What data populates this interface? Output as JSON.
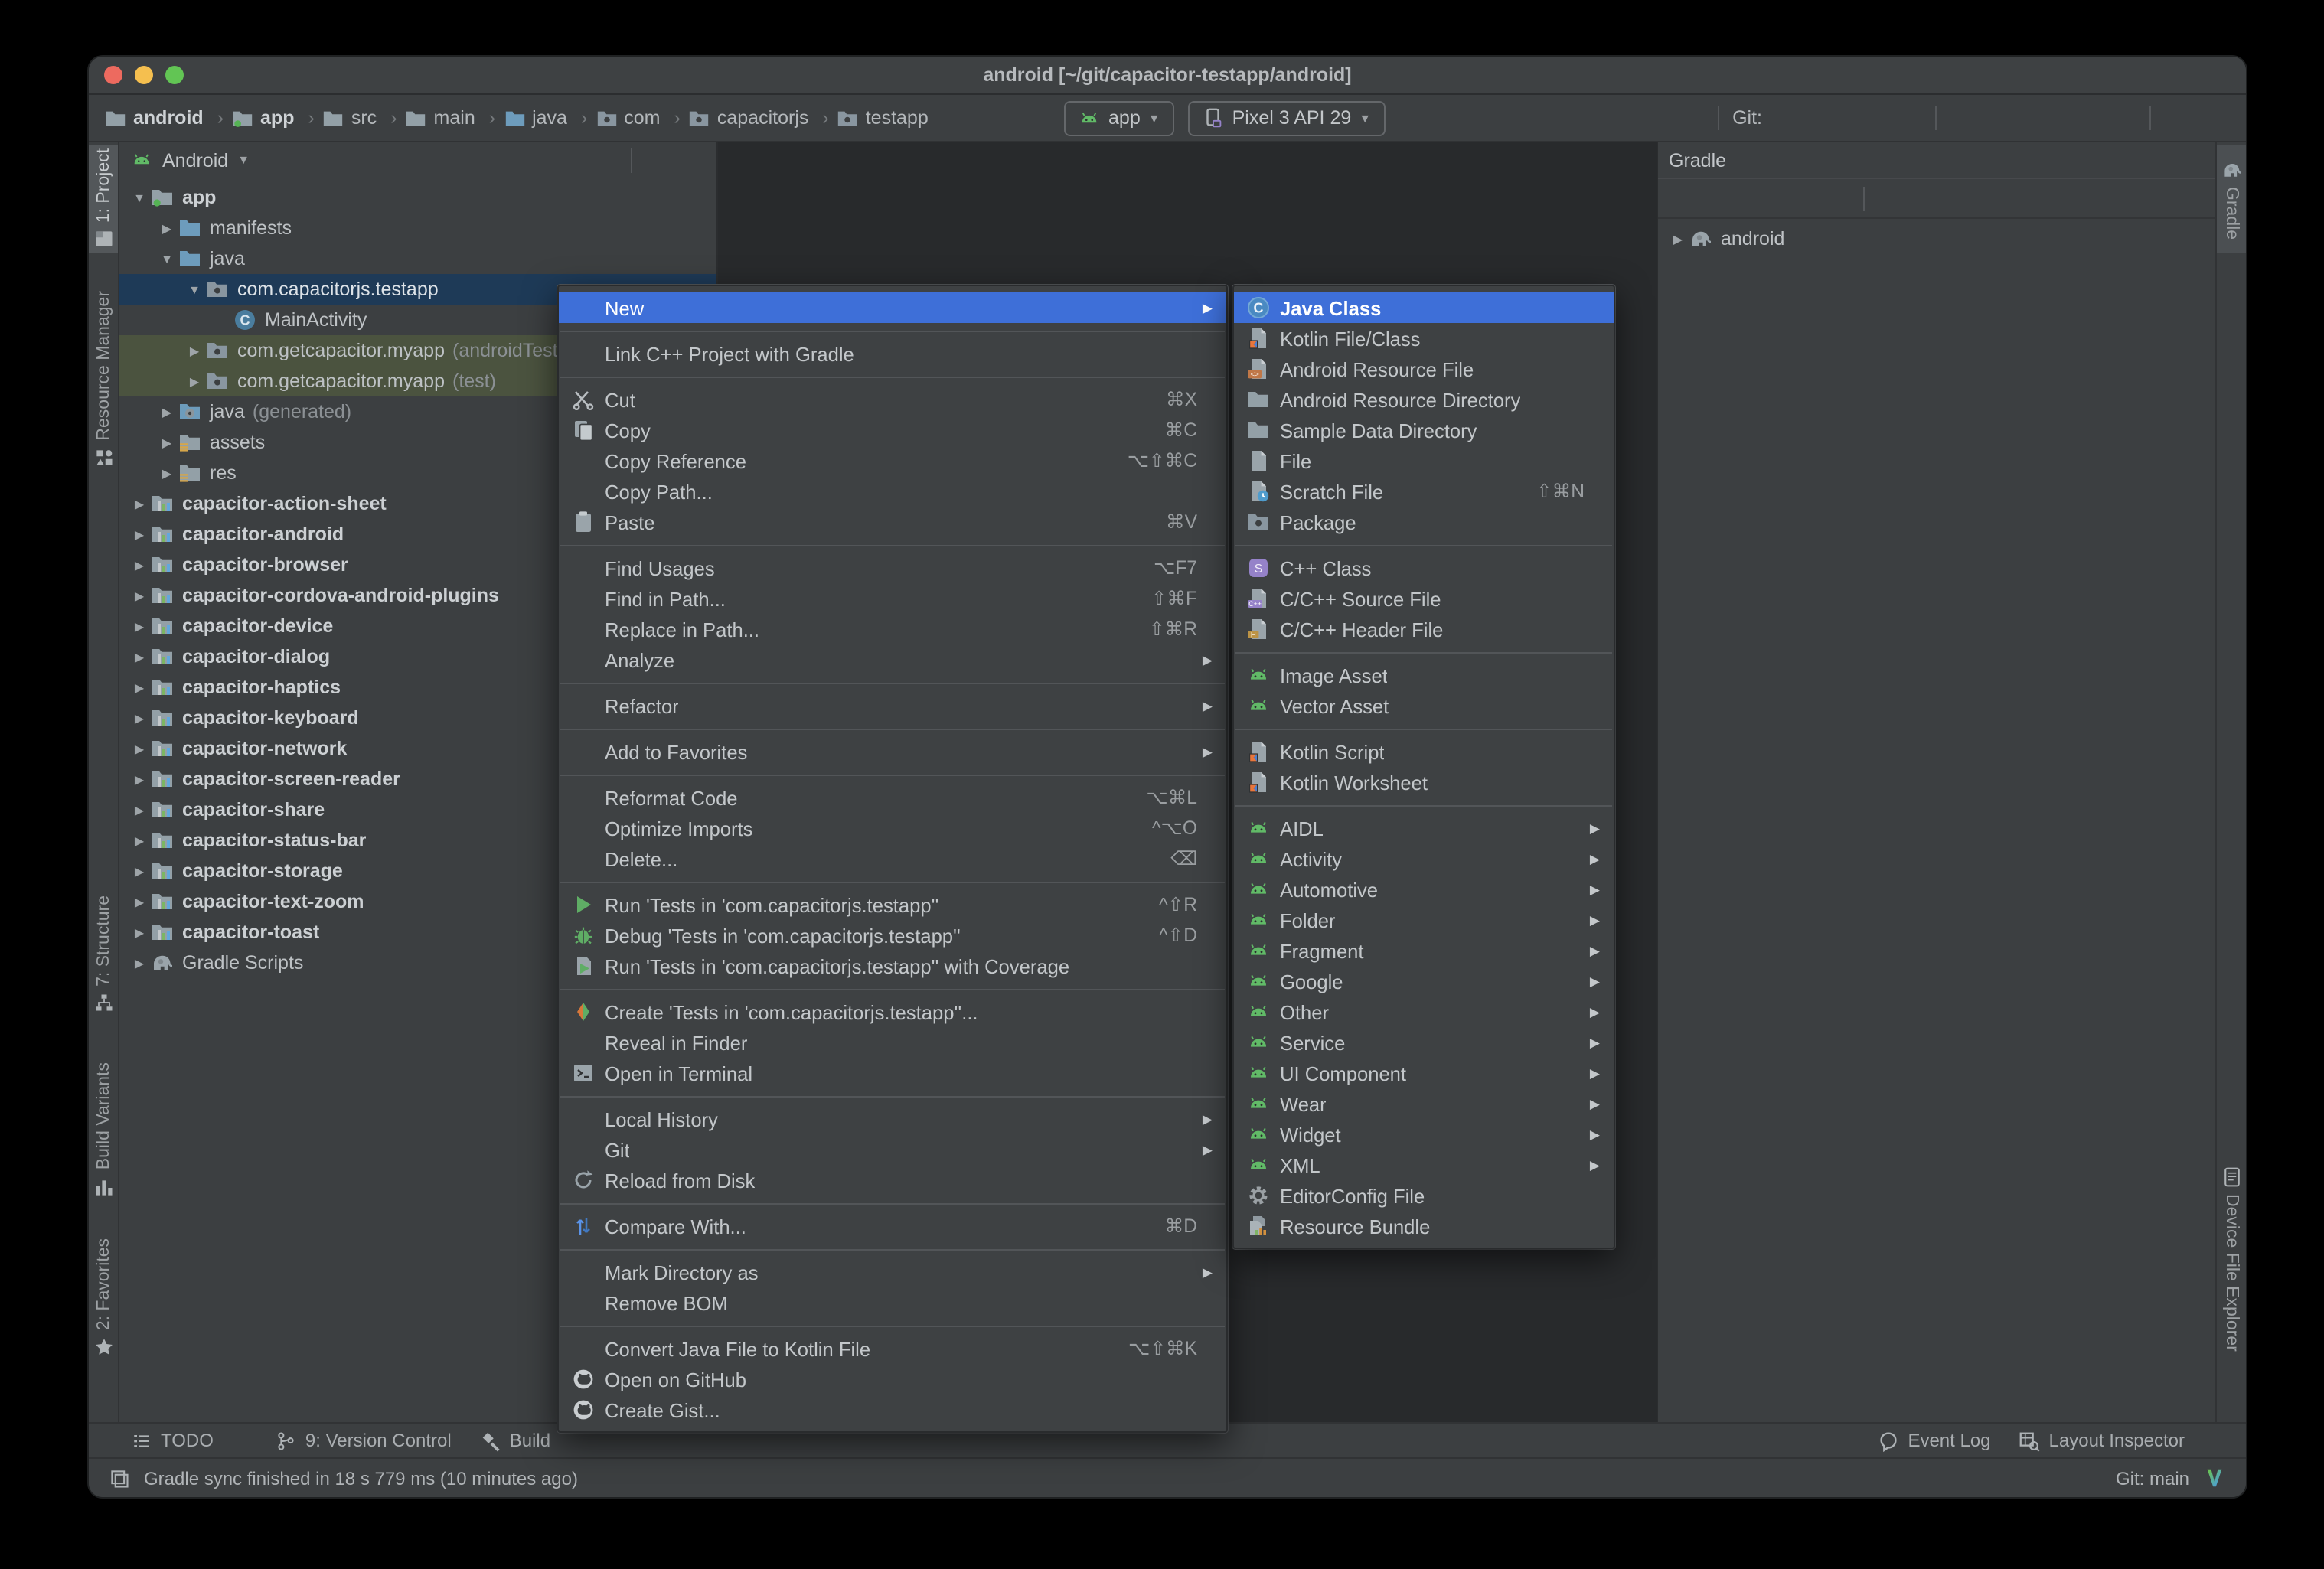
{
  "window": {
    "title": "android [~/git/capacitor-testapp/android]"
  },
  "toolbar": {
    "breadcrumbs": [
      {
        "label": "android",
        "icon": "folder-grey",
        "bold": true
      },
      {
        "label": "app",
        "icon": "folder-dot",
        "bold": true
      },
      {
        "label": "src",
        "icon": "folder-grey"
      },
      {
        "label": "main",
        "icon": "folder-grey"
      },
      {
        "label": "java",
        "icon": "folder-blue"
      },
      {
        "label": "com",
        "icon": "package"
      },
      {
        "label": "capacitorjs",
        "icon": "package"
      },
      {
        "label": "testapp",
        "icon": "package"
      }
    ],
    "pre_actions": [
      {
        "icon": "build-hammer"
      }
    ],
    "run_config": {
      "icon": "android",
      "label": "app"
    },
    "device": {
      "icon": "phone",
      "label": "Pixel 3 API 29"
    },
    "run_actions": [
      {
        "icon": "play-green"
      },
      {
        "icon": "apply-changes"
      },
      {
        "icon": "apply-code-changes"
      },
      {
        "icon": "bug-green"
      },
      {
        "icon": "attach-debugger"
      },
      {
        "icon": "profiler"
      },
      {
        "icon": "profile-run"
      },
      {
        "icon": "stop"
      }
    ],
    "git_label": "Git:",
    "git_actions": [
      {
        "icon": "update"
      },
      {
        "icon": "commit"
      },
      {
        "icon": "clock"
      },
      {
        "icon": "rollback"
      }
    ],
    "tool_actions": [
      {
        "icon": "project-structure"
      },
      {
        "icon": "run-anything"
      },
      {
        "icon": "elephant-sync"
      },
      {
        "icon": "avd-manager"
      },
      {
        "icon": "sdk-manager"
      }
    ],
    "tail_actions": [
      {
        "icon": "search"
      },
      {
        "icon": "avatar"
      }
    ]
  },
  "left_stripe": {
    "items": [
      {
        "label": "1: Project",
        "icon": "project-tab",
        "active": true
      },
      {
        "label": "Resource Manager",
        "icon": "resource-manager"
      },
      {
        "label": "7: Structure",
        "icon": "structure-tab"
      },
      {
        "label": "Build Variants",
        "icon": "build-variants"
      },
      {
        "label": "2: Favorites",
        "icon": "favorites"
      }
    ]
  },
  "right_stripe": {
    "items": [
      {
        "label": "Gradle",
        "icon": "elephant"
      },
      {
        "label": "Device File Explorer",
        "icon": "device-file-explorer"
      }
    ]
  },
  "project_panel": {
    "view_selector": "Android",
    "header_actions": [
      {
        "icon": "locate"
      },
      {
        "icon": "collapse-all"
      },
      {
        "type": "sep"
      },
      {
        "icon": "gear"
      },
      {
        "icon": "minus"
      }
    ],
    "tree": [
      {
        "label": "app",
        "icon": "folder-dot",
        "arrow": "exp",
        "indent": 0,
        "bold": true
      },
      {
        "label": "manifests",
        "icon": "folder-blue",
        "arrow": "col",
        "indent": 1
      },
      {
        "label": "java",
        "icon": "folder-blue",
        "arrow": "exp",
        "indent": 1
      },
      {
        "label": "com.capacitorjs.testapp",
        "icon": "package",
        "arrow": "exp",
        "indent": 2,
        "sel": true
      },
      {
        "label": "MainActivity",
        "icon": "class-c",
        "indent": 3
      },
      {
        "label": "com.getcapacitor.myapp",
        "suffix": "(androidTest)",
        "icon": "package",
        "arrow": "col",
        "indent": 2,
        "test": true
      },
      {
        "label": "com.getcapacitor.myapp",
        "suffix": "(test)",
        "icon": "package",
        "arrow": "col",
        "indent": 2,
        "test": true
      },
      {
        "label": "java",
        "suffix": "(generated)",
        "icon": "folder-gen",
        "arrow": "col",
        "indent": 1
      },
      {
        "label": "assets",
        "icon": "folder-res",
        "arrow": "col",
        "indent": 1
      },
      {
        "label": "res",
        "icon": "folder-res",
        "arrow": "col",
        "indent": 1
      },
      {
        "label": "capacitor-action-sheet",
        "icon": "module",
        "arrow": "col",
        "indent": 0,
        "bold": true
      },
      {
        "label": "capacitor-android",
        "icon": "module",
        "arrow": "col",
        "indent": 0,
        "bold": true
      },
      {
        "label": "capacitor-browser",
        "icon": "module",
        "arrow": "col",
        "indent": 0,
        "bold": true
      },
      {
        "label": "capacitor-cordova-android-plugins",
        "icon": "module",
        "arrow": "col",
        "indent": 0,
        "bold": true
      },
      {
        "label": "capacitor-device",
        "icon": "module",
        "arrow": "col",
        "indent": 0,
        "bold": true
      },
      {
        "label": "capacitor-dialog",
        "icon": "module",
        "arrow": "col",
        "indent": 0,
        "bold": true
      },
      {
        "label": "capacitor-haptics",
        "icon": "module",
        "arrow": "col",
        "indent": 0,
        "bold": true
      },
      {
        "label": "capacitor-keyboard",
        "icon": "module",
        "arrow": "col",
        "indent": 0,
        "bold": true
      },
      {
        "label": "capacitor-network",
        "icon": "module",
        "arrow": "col",
        "indent": 0,
        "bold": true
      },
      {
        "label": "capacitor-screen-reader",
        "icon": "module",
        "arrow": "col",
        "indent": 0,
        "bold": true
      },
      {
        "label": "capacitor-share",
        "icon": "module",
        "arrow": "col",
        "indent": 0,
        "bold": true
      },
      {
        "label": "capacitor-status-bar",
        "icon": "module",
        "arrow": "col",
        "indent": 0,
        "bold": true
      },
      {
        "label": "capacitor-storage",
        "icon": "module",
        "arrow": "col",
        "indent": 0,
        "bold": true
      },
      {
        "label": "capacitor-text-zoom",
        "icon": "module",
        "arrow": "col",
        "indent": 0,
        "bold": true
      },
      {
        "label": "capacitor-toast",
        "icon": "module",
        "arrow": "col",
        "indent": 0,
        "bold": true
      },
      {
        "label": "Gradle Scripts",
        "icon": "elephant",
        "arrow": "col",
        "indent": 0
      }
    ]
  },
  "gradle_panel": {
    "title": "Gradle",
    "header_actions": [
      {
        "icon": "gear"
      },
      {
        "icon": "minus"
      }
    ],
    "toolbar_actions": [
      {
        "icon": "plus"
      },
      {
        "icon": "minus"
      },
      {
        "icon": "elephant"
      },
      {
        "icon": "expand-all"
      },
      {
        "icon": "collapse-all"
      },
      {
        "type": "sep"
      },
      {
        "icon": "offline"
      },
      {
        "icon": "wrench"
      }
    ],
    "tree": [
      {
        "label": "android",
        "icon": "elephant",
        "arrow": "col",
        "indent": 0
      }
    ]
  },
  "context_menu": {
    "items": [
      {
        "label": "New",
        "sel": true,
        "sub": true
      },
      {
        "type": "sep"
      },
      {
        "label": "Link C++ Project with Gradle"
      },
      {
        "type": "sep"
      },
      {
        "label": "Cut",
        "icon": "scissors",
        "shortcut": "⌘X"
      },
      {
        "label": "Copy",
        "icon": "copy",
        "shortcut": "⌘C"
      },
      {
        "label": "Copy Reference",
        "shortcut": "⌥⇧⌘C"
      },
      {
        "label": "Copy Path..."
      },
      {
        "label": "Paste",
        "icon": "paste",
        "shortcut": "⌘V"
      },
      {
        "type": "sep"
      },
      {
        "label": "Find Usages",
        "shortcut": "⌥F7"
      },
      {
        "label": "Find in Path...",
        "shortcut": "⇧⌘F"
      },
      {
        "label": "Replace in Path...",
        "shortcut": "⇧⌘R"
      },
      {
        "label": "Analyze",
        "sub": true
      },
      {
        "type": "sep"
      },
      {
        "label": "Refactor",
        "sub": true
      },
      {
        "type": "sep"
      },
      {
        "label": "Add to Favorites",
        "sub": true
      },
      {
        "type": "sep"
      },
      {
        "label": "Reformat Code",
        "shortcut": "⌥⌘L"
      },
      {
        "label": "Optimize Imports",
        "shortcut": "^⌥O"
      },
      {
        "label": "Delete...",
        "shortcut": "⌫"
      },
      {
        "type": "sep"
      },
      {
        "label": "Run 'Tests in 'com.capacitorjs.testapp''",
        "icon": "play-green",
        "shortcut": "^⇧R"
      },
      {
        "label": "Debug 'Tests in 'com.capacitorjs.testapp''",
        "icon": "bug-green",
        "shortcut": "^⇧D"
      },
      {
        "label": "Run 'Tests in 'com.capacitorjs.testapp'' with Coverage",
        "icon": "coverage"
      },
      {
        "type": "sep"
      },
      {
        "label": "Create 'Tests in 'com.capacitorjs.testapp''...",
        "icon": "create-test"
      },
      {
        "label": "Reveal in Finder"
      },
      {
        "label": "Open in Terminal",
        "icon": "terminal"
      },
      {
        "type": "sep"
      },
      {
        "label": "Local History",
        "sub": true
      },
      {
        "label": "Git",
        "sub": true
      },
      {
        "label": "Reload from Disk",
        "icon": "reload"
      },
      {
        "type": "sep"
      },
      {
        "label": "Compare With...",
        "icon": "compare",
        "shortcut": "⌘D"
      },
      {
        "type": "sep"
      },
      {
        "label": "Mark Directory as",
        "sub": true
      },
      {
        "label": "Remove BOM"
      },
      {
        "type": "sep"
      },
      {
        "label": "Convert Java File to Kotlin File",
        "shortcut": "⌥⇧⌘K"
      },
      {
        "label": "Open on GitHub",
        "icon": "github"
      },
      {
        "label": "Create Gist...",
        "icon": "github"
      }
    ]
  },
  "new_submenu": {
    "items": [
      {
        "label": "Java Class",
        "icon": "class-c-blue",
        "sel": true,
        "bold": true
      },
      {
        "label": "Kotlin File/Class",
        "icon": "kotlin-file"
      },
      {
        "label": "Android Resource File",
        "icon": "res-file"
      },
      {
        "label": "Android Resource Directory",
        "icon": "folder-grey"
      },
      {
        "label": "Sample Data Directory",
        "icon": "folder-grey"
      },
      {
        "label": "File",
        "icon": "file"
      },
      {
        "label": "Scratch File",
        "icon": "file-clock",
        "shortcut": "⇧⌘N"
      },
      {
        "label": "Package",
        "icon": "package"
      },
      {
        "type": "sep"
      },
      {
        "label": "C++ Class",
        "icon": "cpp-class"
      },
      {
        "label": "C/C++ Source File",
        "icon": "cpp-source"
      },
      {
        "label": "C/C++ Header File",
        "icon": "cpp-header"
      },
      {
        "type": "sep"
      },
      {
        "label": "Image Asset",
        "icon": "android"
      },
      {
        "label": "Vector Asset",
        "icon": "android"
      },
      {
        "type": "sep"
      },
      {
        "label": "Kotlin Script",
        "icon": "kotlin-file"
      },
      {
        "label": "Kotlin Worksheet",
        "icon": "kotlin-file"
      },
      {
        "type": "sep"
      },
      {
        "label": "AIDL",
        "icon": "android",
        "sub": true
      },
      {
        "label": "Activity",
        "icon": "android",
        "sub": true
      },
      {
        "label": "Automotive",
        "icon": "android",
        "sub": true
      },
      {
        "label": "Folder",
        "icon": "android",
        "sub": true
      },
      {
        "label": "Fragment",
        "icon": "android",
        "sub": true
      },
      {
        "label": "Google",
        "icon": "android",
        "sub": true
      },
      {
        "label": "Other",
        "icon": "android",
        "sub": true
      },
      {
        "label": "Service",
        "icon": "android",
        "sub": true
      },
      {
        "label": "UI Component",
        "icon": "android",
        "sub": true
      },
      {
        "label": "Wear",
        "icon": "android",
        "sub": true
      },
      {
        "label": "Widget",
        "icon": "android",
        "sub": true
      },
      {
        "label": "XML",
        "icon": "android",
        "sub": true
      },
      {
        "label": "EditorConfig File",
        "icon": "gear"
      },
      {
        "label": "Resource Bundle",
        "icon": "res-bundle"
      }
    ]
  },
  "bottom_bar": {
    "left": [
      {
        "icon": "todo",
        "label": "TODO"
      },
      {
        "icon": "branch",
        "label": "9: Version Control"
      },
      {
        "icon": "hammer",
        "label": "Build"
      }
    ],
    "right": [
      {
        "icon": "event-log",
        "label": "Event Log"
      },
      {
        "icon": "layout-inspector",
        "label": "Layout Inspector"
      }
    ]
  },
  "status_bar": {
    "toggle_icon": "stripes-toggle",
    "message": "Gradle sync finished in 18 s 779 ms (10 minutes ago)",
    "git_branch": "Git: main",
    "branch_icon": "v-gradient"
  },
  "colors": {
    "panel": "#3c3f41",
    "editor": "#282a2c",
    "menu_selection": "#3e6fd8",
    "tree_selection": "#1e3a57",
    "test_source_row": "#4b533f",
    "traffic_red": "#ed6a5f",
    "traffic_yellow": "#f5bf4f",
    "traffic_green": "#62c554"
  }
}
